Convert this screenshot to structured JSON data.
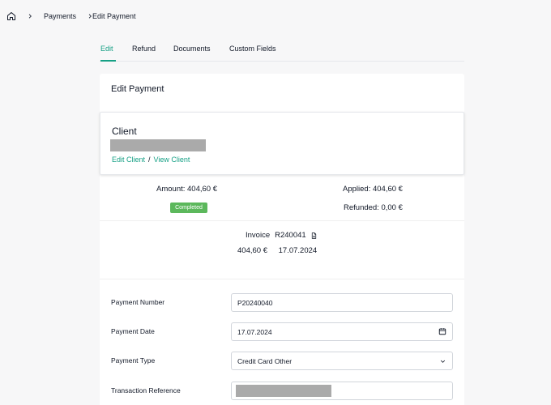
{
  "breadcrumb": {
    "home_icon": "home-icon",
    "items": [
      "Payments",
      "Edit Payment"
    ]
  },
  "tabs": [
    {
      "label": "Edit",
      "active": true
    },
    {
      "label": "Refund",
      "active": false
    },
    {
      "label": "Documents",
      "active": false
    },
    {
      "label": "Custom Fields",
      "active": false
    }
  ],
  "card": {
    "title": "Edit Payment",
    "client": {
      "heading": "Client",
      "edit_link": "Edit Client",
      "separator": "/",
      "view_link": "View Client"
    },
    "summary": {
      "amount": "Amount: 404,60 €",
      "status": "Completed",
      "applied": "Applied: 404,60 €",
      "refunded": "Refunded: 0,00 €"
    },
    "invoice": {
      "label": "Invoice",
      "number": "R240041",
      "amount": "404,60 €",
      "date": "17.07.2024"
    },
    "form": {
      "payment_number": {
        "label": "Payment Number",
        "value": "P20240040"
      },
      "payment_date": {
        "label": "Payment Date",
        "value": "17.07.2024"
      },
      "payment_type": {
        "label": "Payment Type",
        "value": "Credit Card Other"
      },
      "transaction_reference": {
        "label": "Transaction Reference",
        "value": ""
      }
    }
  },
  "colors": {
    "accent": "#16a085",
    "badge": "#5cb85c",
    "background": "#f7f7f8"
  }
}
